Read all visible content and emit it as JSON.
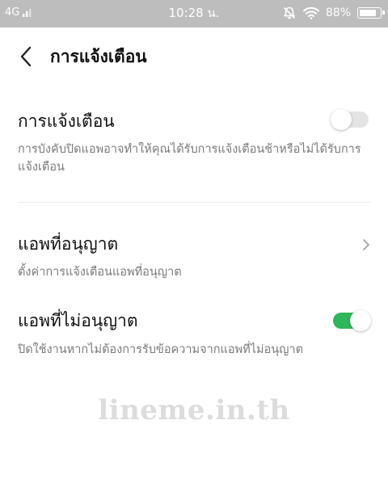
{
  "status_bar": {
    "network": "4G",
    "time": "10:28 น.",
    "battery": "88%",
    "battery_level": 0.88
  },
  "header": {
    "title": "การแจ้งเตือน"
  },
  "notifications_setting": {
    "title": "การแจ้งเตือน",
    "description": "การบังคับปิดแอพอาจทำให้คุณได้รับการแจ้งเตือนช้าหรือไม่ได้รับการแจ้งเตือน",
    "enabled": false
  },
  "allowed_apps": {
    "title": "แอพที่อนุญาต",
    "description": "ตั้งค่าการแจ้งเตือนแอพที่อนุญาต"
  },
  "disallowed_apps": {
    "title": "แอพที่ไม่อนุญาต",
    "description": "ปิดใช้งานหากไม่ต้องการรับข้อความจากแอพที่ไม่อนุญาต",
    "enabled": true
  },
  "watermark": "lineme.in.th",
  "colors": {
    "status_bar": "#bdbdbd",
    "toggle_on": "#2fb55a",
    "toggle_off": "#e4e4e4",
    "description_text": "#7a7a7a"
  }
}
